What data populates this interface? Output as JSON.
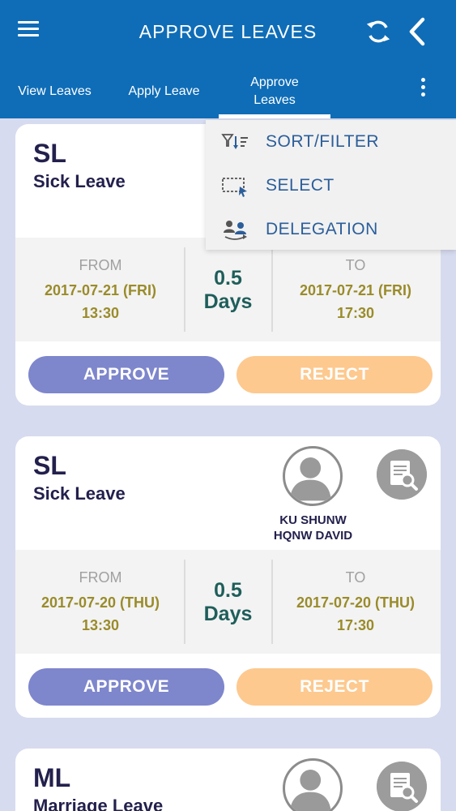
{
  "header": {
    "title": "APPROVE LEAVES",
    "menu_icon": "menu-icon",
    "refresh_icon": "refresh-icon",
    "back_icon": "chevron-left-icon"
  },
  "tabs": [
    {
      "label": "View Leaves"
    },
    {
      "label": "Apply Leave"
    },
    {
      "label_line1": "Approve",
      "label_line2": "Leaves"
    }
  ],
  "overflow_menu": {
    "items": [
      {
        "label": "SORT/FILTER",
        "icon": "sort-filter-icon"
      },
      {
        "label": "SELECT",
        "icon": "select-icon"
      },
      {
        "label": "DELEGATION",
        "icon": "delegation-icon"
      }
    ]
  },
  "leaves": [
    {
      "code": "SL",
      "type": "Sick Leave",
      "from_label": "FROM",
      "from_date": "2017-07-21 (FRI)",
      "from_time": "13:30",
      "duration_value": "0.5",
      "duration_unit": "Days",
      "to_label": "TO",
      "to_date": "2017-07-21 (FRI)",
      "to_time": "17:30",
      "approve_label": "APPROVE",
      "reject_label": "REJECT"
    },
    {
      "code": "SL",
      "type": "Sick Leave",
      "employee_line1": "KU SHUNW",
      "employee_line2": "HQNW DAVID",
      "from_label": "FROM",
      "from_date": "2017-07-20 (THU)",
      "from_time": "13:30",
      "duration_value": "0.5",
      "duration_unit": "Days",
      "to_label": "TO",
      "to_date": "2017-07-20 (THU)",
      "to_time": "17:30",
      "approve_label": "APPROVE",
      "reject_label": "REJECT"
    },
    {
      "code": "ML",
      "type": "Marriage Leave"
    }
  ],
  "colors": {
    "header_bg": "#0f6db7",
    "approve": "#7e86cc",
    "reject": "#fdc98f",
    "date_text": "#9a8b2a",
    "days_text": "#1f5e5a"
  }
}
